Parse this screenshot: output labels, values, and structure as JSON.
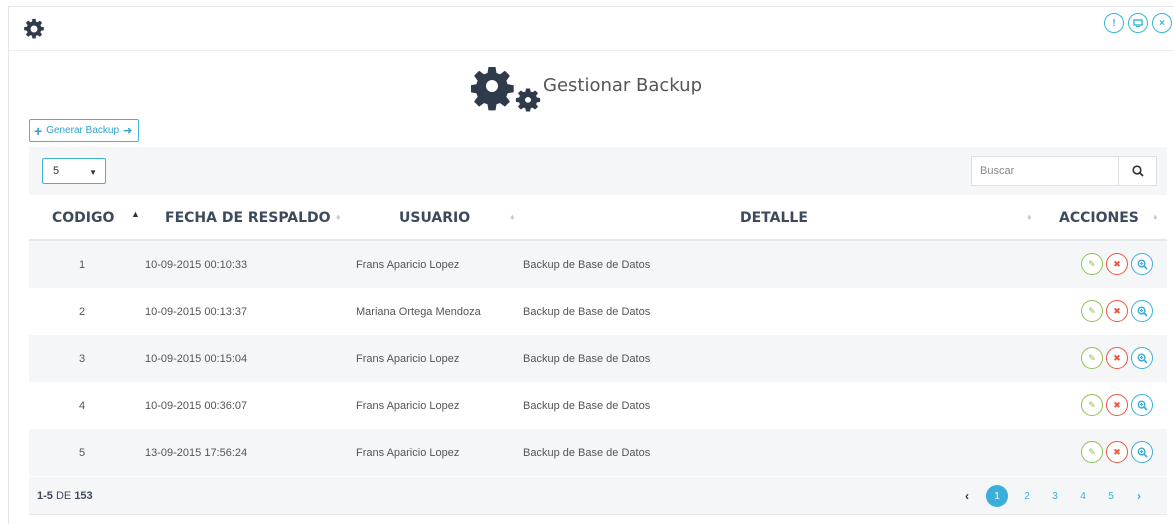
{
  "window": {
    "icons": [
      "info-icon",
      "window-icon",
      "close-icon"
    ]
  },
  "page": {
    "title": "Gestionar Backup",
    "generate_button": "Generar Backup"
  },
  "controls": {
    "page_size": "5",
    "search_placeholder": "Buscar"
  },
  "table": {
    "columns": [
      {
        "label": "CODIGO",
        "sort": "asc"
      },
      {
        "label": "FECHA DE RESPALDO",
        "sort": "none"
      },
      {
        "label": "USUARIO",
        "sort": "none"
      },
      {
        "label": "DETALLE",
        "sort": "none"
      },
      {
        "label": "ACCIONES",
        "sort": "none"
      }
    ],
    "rows": [
      {
        "codigo": "1",
        "fecha": "10-09-2015 00:10:33",
        "usuario": "Frans Aparicio Lopez",
        "detalle": "Backup de Base de Datos"
      },
      {
        "codigo": "2",
        "fecha": "10-09-2015 00:13:37",
        "usuario": "Mariana Ortega Mendoza",
        "detalle": "Backup de Base de Datos"
      },
      {
        "codigo": "3",
        "fecha": "10-09-2015 00:15:04",
        "usuario": "Frans Aparicio Lopez",
        "detalle": "Backup de Base de Datos"
      },
      {
        "codigo": "4",
        "fecha": "10-09-2015 00:36:07",
        "usuario": "Frans Aparicio Lopez",
        "detalle": "Backup de Base de Datos"
      },
      {
        "codigo": "5",
        "fecha": "13-09-2015 17:56:24",
        "usuario": "Frans Aparicio Lopez",
        "detalle": "Backup de Base de Datos"
      }
    ]
  },
  "footer": {
    "range": "1-5",
    "of_label": "DE",
    "total": "153"
  },
  "pagination": {
    "pages": [
      "1",
      "2",
      "3",
      "4",
      "5"
    ],
    "active": "1"
  },
  "colors": {
    "accent": "#3bafda",
    "edit": "#8cc152",
    "delete": "#e9573f",
    "header_text": "#3d4a5c",
    "stripe": "#f5f6f8"
  }
}
